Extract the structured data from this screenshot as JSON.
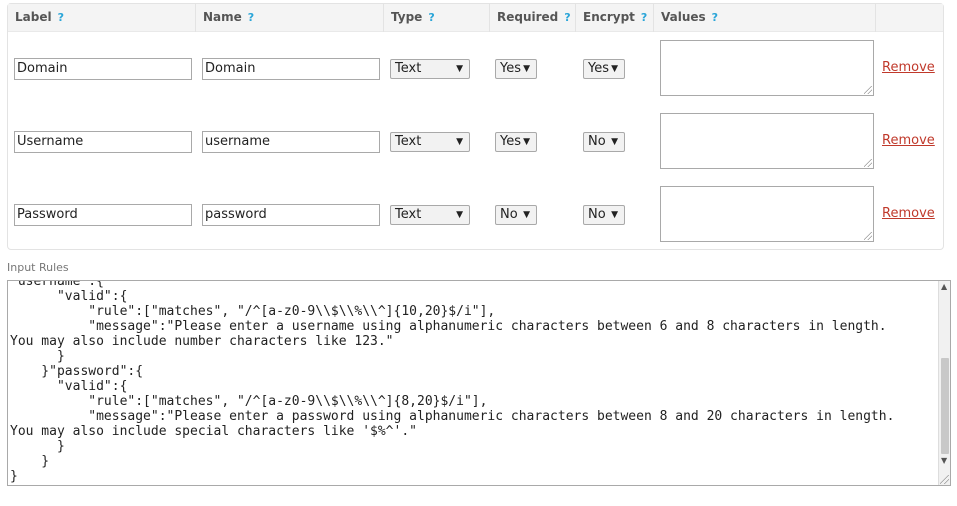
{
  "fields_table": {
    "headers": [
      {
        "label": "Label",
        "help": "?"
      },
      {
        "label": "Name",
        "help": "?"
      },
      {
        "label": "Type",
        "help": "?"
      },
      {
        "label": "Required",
        "help": "?"
      },
      {
        "label": "Encrypt",
        "help": "?"
      },
      {
        "label": "Values",
        "help": "?"
      }
    ],
    "rows": [
      {
        "label": "Domain",
        "name": "Domain",
        "type": "Text",
        "required": "Yes",
        "encrypt": "Yes",
        "values": "",
        "remove": "Remove"
      },
      {
        "label": "Username",
        "name": "username",
        "type": "Text",
        "required": "Yes",
        "encrypt": "No",
        "values": "",
        "remove": "Remove"
      },
      {
        "label": "Password",
        "name": "password",
        "type": "Text",
        "required": "No",
        "encrypt": "No",
        "values": "",
        "remove": "Remove"
      }
    ]
  },
  "input_rules": {
    "label": "Input Rules",
    "content": "\"username\":{\n      \"valid\":{\n          \"rule\":[\"matches\", \"/^[a-z0-9\\\\$\\\\%\\\\^]{10,20}$/i\"],\n          \"message\":\"Please enter a username using alphanumeric characters between 6 and 8 characters in length.\nYou may also include number characters like 123.\"\n      }\n    }\"password\":{\n      \"valid\":{\n          \"rule\":[\"matches\", \"/^[a-z0-9\\\\$\\\\%\\\\^]{8,20}$/i\"],\n          \"message\":\"Please enter a password using alphanumeric characters between 8 and 20 characters in length.\nYou may also include special characters like '$%^'.\"\n      }\n    }\n}"
  },
  "icons": {
    "select_arrow": "triangle-down",
    "scroll_up": "triangle-up",
    "scroll_down": "triangle-down"
  }
}
